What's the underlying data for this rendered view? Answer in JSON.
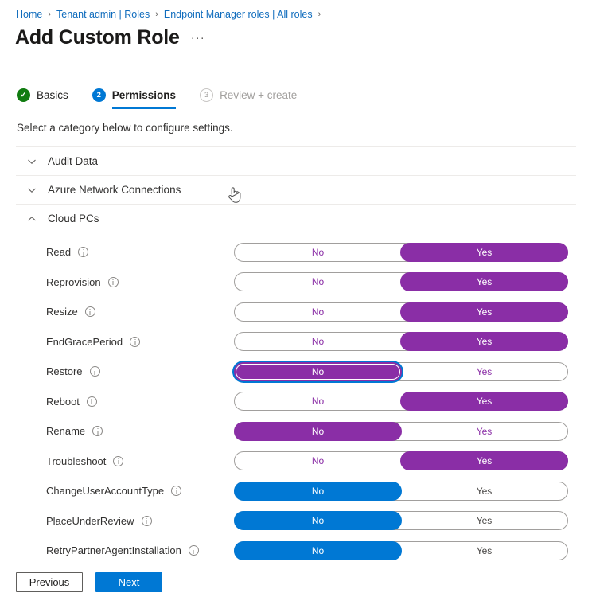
{
  "breadcrumb": {
    "items": [
      {
        "label": "Home"
      },
      {
        "label": "Tenant admin | Roles"
      },
      {
        "label": "Endpoint Manager roles | All roles"
      }
    ],
    "separator": "›"
  },
  "header": {
    "title": "Add Custom Role",
    "more_label": "···"
  },
  "wizard": {
    "steps": [
      {
        "marker": "✓",
        "label": "Basics",
        "state": "done"
      },
      {
        "marker": "2",
        "label": "Permissions",
        "state": "current"
      },
      {
        "marker": "3",
        "label": "Review + create",
        "state": "future"
      }
    ]
  },
  "subtitle": "Select a category below to configure settings.",
  "sections": [
    {
      "title": "Audit Data",
      "expanded": false,
      "chevron": "chevron-down-icon"
    },
    {
      "title": "Azure Network Connections",
      "expanded": false,
      "chevron": "chevron-down-icon"
    },
    {
      "title": "Cloud PCs",
      "expanded": true,
      "chevron": "chevron-up-icon"
    }
  ],
  "toggle_labels": {
    "no": "No",
    "yes": "Yes"
  },
  "permissions": [
    {
      "name": "Read",
      "value": "Yes",
      "accent": "purple",
      "focused": false
    },
    {
      "name": "Reprovision",
      "value": "Yes",
      "accent": "purple",
      "focused": false
    },
    {
      "name": "Resize",
      "value": "Yes",
      "accent": "purple",
      "focused": false
    },
    {
      "name": "EndGracePeriod",
      "value": "Yes",
      "accent": "purple",
      "focused": false
    },
    {
      "name": "Restore",
      "value": "No",
      "accent": "purple",
      "focused": true
    },
    {
      "name": "Reboot",
      "value": "Yes",
      "accent": "purple",
      "focused": false
    },
    {
      "name": "Rename",
      "value": "No",
      "accent": "purple",
      "focused": false
    },
    {
      "name": "Troubleshoot",
      "value": "Yes",
      "accent": "purple",
      "focused": false
    },
    {
      "name": "ChangeUserAccountType",
      "value": "No",
      "accent": "blue",
      "focused": false
    },
    {
      "name": "PlaceUnderReview",
      "value": "No",
      "accent": "blue",
      "focused": false
    },
    {
      "name": "RetryPartnerAgentInstallation",
      "value": "No",
      "accent": "blue",
      "focused": false
    }
  ],
  "footer": {
    "previous_label": "Previous",
    "next_label": "Next"
  },
  "colors": {
    "purple": "#8a2ea6",
    "blue": "#0078d4",
    "green": "#107c10",
    "link": "#0f6cbd"
  }
}
